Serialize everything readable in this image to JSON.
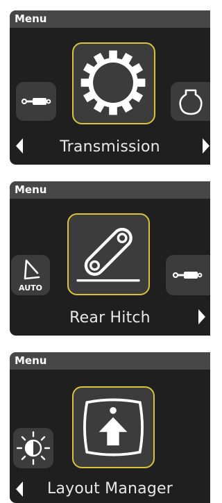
{
  "panels": [
    {
      "title": "Menu",
      "selected_label": "Transmission",
      "left_icon": "hydraulic-cylinder-icon",
      "center_icon": "gear-icon",
      "right_icon": "pto-shaft-icon"
    },
    {
      "title": "Menu",
      "selected_label": "Rear Hitch",
      "left_icon": "auto-steer-icon",
      "left_icon_text": "AUTO",
      "center_icon": "rear-hitch-icon",
      "right_icon": "hydraulic-cylinder-icon"
    },
    {
      "title": "Menu",
      "selected_label": "Layout Manager",
      "left_icon": "brightness-icon",
      "center_icon": "layout-manager-icon"
    }
  ],
  "colors": {
    "panel_background": "#1f1f1f",
    "title_bar": "#474747",
    "tile": "#3c3c3c",
    "selection_border": "#d9c43a",
    "text": "#ffffff"
  }
}
